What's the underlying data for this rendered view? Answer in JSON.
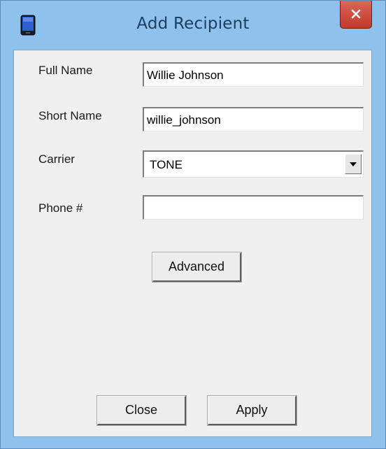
{
  "window": {
    "title": "Add Recipient",
    "icon": "phone-icon",
    "close_icon": "close-icon"
  },
  "form": {
    "full_name": {
      "label": "Full Name",
      "value": "Willie Johnson"
    },
    "short_name": {
      "label": "Short Name",
      "value": "willie_johnson"
    },
    "carrier": {
      "label": "Carrier",
      "value": "TONE",
      "dropdown_icon": "chevron-down-icon"
    },
    "phone": {
      "label": "Phone #",
      "value": ""
    }
  },
  "buttons": {
    "advanced": "Advanced",
    "close": "Close",
    "apply": "Apply"
  },
  "colors": {
    "frame": "#8ec2ec",
    "client_bg": "#f0f0f0",
    "close_button": "#c9473a",
    "title_text": "#1e3c5e"
  }
}
